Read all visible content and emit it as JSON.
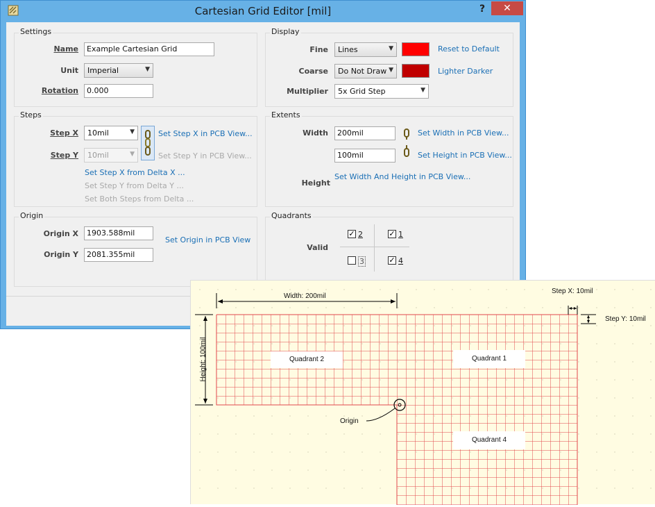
{
  "window": {
    "title": "Cartesian Grid Editor [mil]",
    "help": "?",
    "close": "✕"
  },
  "settings": {
    "group_title": "Settings",
    "name_label": "Name",
    "name_value": "Example Cartesian Grid",
    "unit_label": "Unit",
    "unit_value": "Imperial",
    "rotation_label": "Rotation",
    "rotation_value": "0.000"
  },
  "display": {
    "group_title": "Display",
    "fine_label": "Fine",
    "fine_value": "Lines",
    "fine_color": "#ff0000",
    "coarse_label": "Coarse",
    "coarse_value": "Do Not Draw",
    "coarse_color": "#c00000",
    "multiplier_label": "Multiplier",
    "multiplier_value": "5x Grid Step",
    "reset_link": "Reset to Default",
    "lighter_darker_link": "Lighter Darker"
  },
  "steps": {
    "group_title": "Steps",
    "step_x_label": "Step X",
    "step_x_value": "10mil",
    "step_y_label": "Step Y",
    "step_y_value": "10mil",
    "set_step_x_link": "Set Step X in PCB View...",
    "set_step_y_link": "Set Step Y in PCB View...",
    "delta_x_link": "Set Step X from Delta X ...",
    "delta_y_link": "Set Step Y from Delta Y ...",
    "both_link": "Set Both Steps from Delta ..."
  },
  "extents": {
    "group_title": "Extents",
    "width_label": "Width",
    "width_value": "200mil",
    "height_label": "Height",
    "height_value": "100mil",
    "set_width_link": "Set Width in PCB View...",
    "set_height_link": "Set Height in PCB View...",
    "set_both_link": "Set Width And Height in PCB View..."
  },
  "origin": {
    "group_title": "Origin",
    "x_label": "Origin X",
    "x_value": "1903.588mil",
    "y_label": "Origin Y",
    "y_value": "2081.355mil",
    "set_origin_link": "Set Origin in PCB View"
  },
  "quadrants": {
    "group_title": "Quadrants",
    "valid_label": "Valid",
    "q2": {
      "label": "2",
      "checked": true
    },
    "q1": {
      "label": "1",
      "checked": true
    },
    "q3": {
      "label": "3",
      "checked": false
    },
    "q4": {
      "label": "4",
      "checked": true
    }
  },
  "diagram": {
    "width_label": "Width: 200mil",
    "height_label": "Height: 100mil",
    "step_x_label": "Step X: 10mil",
    "step_y_label": "Step Y: 10mil",
    "origin_label": "Origin",
    "quadrant2": "Quadrant 2",
    "quadrant1": "Quadrant 1",
    "quadrant4": "Quadrant 4",
    "grid_color": "#e0474c",
    "background_color": "#fffce2"
  }
}
